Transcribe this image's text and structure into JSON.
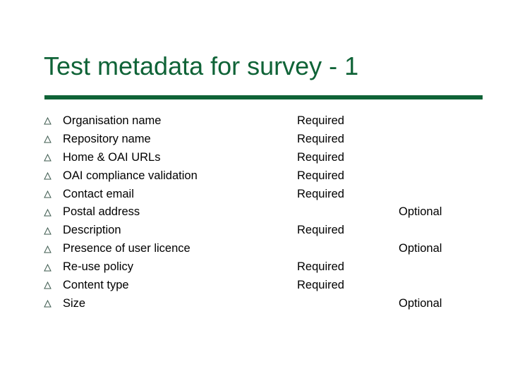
{
  "slide": {
    "title": "Test metadata for survey - 1",
    "accent_color": "#0f6337",
    "bullet_icon": "triangle-outline-icon",
    "items": [
      {
        "label": "Organisation name",
        "required": "Required",
        "optional": ""
      },
      {
        "label": "Repository name",
        "required": "Required",
        "optional": ""
      },
      {
        "label": "Home & OAI URLs",
        "required": "Required",
        "optional": ""
      },
      {
        "label": "OAI compliance validation",
        "required": "Required",
        "optional": ""
      },
      {
        "label": "Contact email",
        "required": "Required",
        "optional": ""
      },
      {
        "label": "Postal address",
        "required": "",
        "optional": "Optional"
      },
      {
        "label": "Description",
        "required": "Required",
        "optional": ""
      },
      {
        "label": "Presence of user licence",
        "required": "",
        "optional": "Optional"
      },
      {
        "label": "Re-use policy",
        "required": "Required",
        "optional": ""
      },
      {
        "label": "Content type",
        "required": "Required",
        "optional": ""
      },
      {
        "label": "Size",
        "required": "",
        "optional": "Optional"
      }
    ]
  }
}
